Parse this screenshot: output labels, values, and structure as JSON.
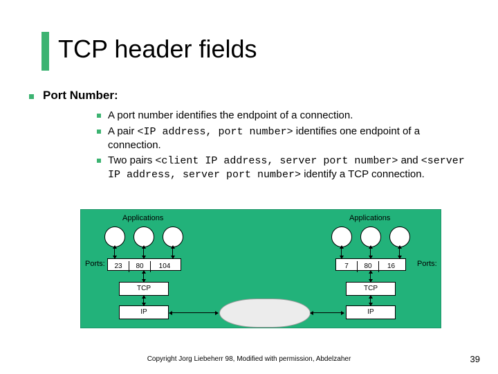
{
  "title": "TCP header fields",
  "heading": "Port Number:",
  "bullets": {
    "b1": "A port number identifies the endpoint of a connection.",
    "b2a": "A pair ",
    "b2code": "<IP address, port number>",
    "b2b": " identifies one endpoint of a connection.",
    "b3a": "Two pairs ",
    "b3code1": "<client IP address, server port number>",
    "b3mid": " and ",
    "b3code2": "<server IP address, server port number>",
    "b3b": " identify a TCP connection."
  },
  "diagram": {
    "appsLeft": "Applications",
    "appsRight": "Applications",
    "portsL": "Ports:",
    "portsR": "Ports:",
    "pL1": "23",
    "pL2": "80",
    "pL3": "104",
    "pR1": "7",
    "pR2": "80",
    "pR3": "16",
    "tcp": "TCP",
    "ip": "IP"
  },
  "footer": "Copyright Jorg Liebeherr 98, Modified with permission, Abdelzaher",
  "page": "39"
}
